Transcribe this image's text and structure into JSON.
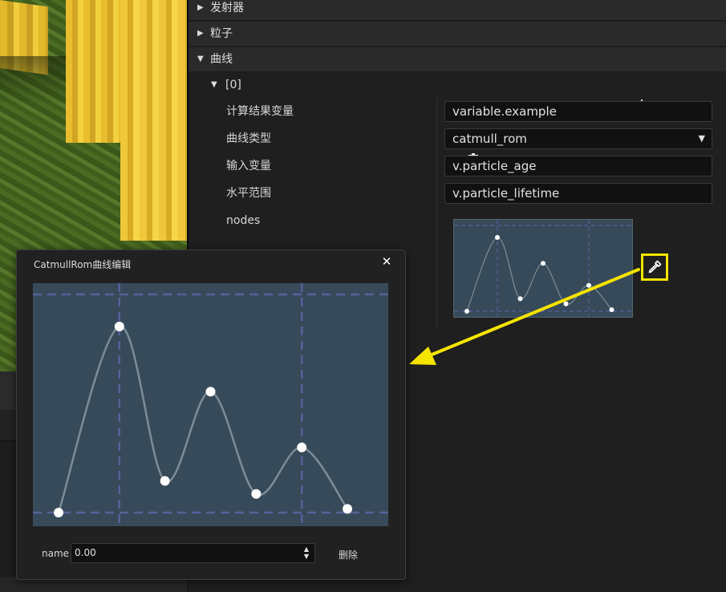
{
  "panel": {
    "sections": [
      {
        "label": "发射器",
        "expanded": false
      },
      {
        "label": "粒子",
        "expanded": false
      },
      {
        "label": "曲线",
        "expanded": true
      }
    ],
    "add_icon": "plus-icon",
    "curve_item": {
      "label": "[0]",
      "delete_icon": "trash-icon",
      "props": [
        {
          "label": "计算结果变量",
          "value": "variable.example"
        },
        {
          "label": "曲线类型",
          "value": "catmull_rom"
        },
        {
          "label": "输入变量",
          "value": "v.particle_age"
        },
        {
          "label": "水平范围",
          "value": "v.particle_lifetime"
        },
        {
          "label": "nodes"
        }
      ],
      "edit_icon": "eyedropper-icon"
    }
  },
  "dialog": {
    "title": "CatmullRom曲线编辑",
    "close_glyph": "✕",
    "name_label": "name",
    "name_value": "0.00",
    "delete_label": "删除"
  },
  "curve": {
    "nodes": [
      [
        0.0,
        0.0
      ],
      [
        0.2,
        1.0
      ],
      [
        0.35,
        0.17
      ],
      [
        0.5,
        0.65
      ],
      [
        0.65,
        0.1
      ],
      [
        0.8,
        0.35
      ],
      [
        0.95,
        0.02
      ]
    ]
  },
  "colors": {
    "highlight": "#f5e400",
    "graph_bg": "#364a5a",
    "grid_dash": "#5a5f9a",
    "curve_line": "#7b8d97",
    "node": "#ffffff"
  }
}
